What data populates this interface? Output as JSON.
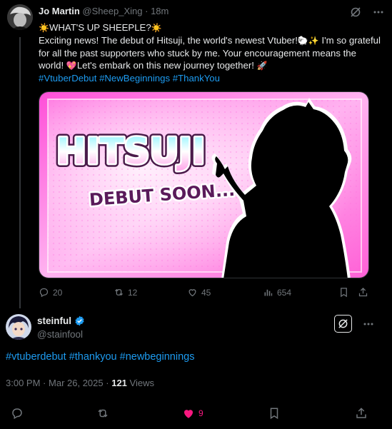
{
  "parent_tweet": {
    "author_name": "Jo Martin",
    "handle": "@Sheep_Xing",
    "separator": "·",
    "time": "18m",
    "text_line_1": "WHAT'S UP SHEEPLE?",
    "text_body": "Exciting news! The debut of Hitsuji, the world's newest Vtuber!",
    "text_body_2": "I'm so grateful for all the past supporters who stuck by me. Your encouragement means the world!",
    "text_body_3": "Let's embark on this new journey together!",
    "hashtags": [
      "#VtuberDebut",
      "#NewBeginnings",
      "#ThankYou"
    ],
    "image": {
      "title": "HITSUJI",
      "subtitle": "DEBUT SOON..."
    },
    "stats": {
      "replies": "20",
      "reposts": "12",
      "likes": "45",
      "views": "654"
    }
  },
  "reply_tweet": {
    "author_name": "steinful",
    "handle": "@stainfool",
    "hashtags": [
      "#vtuberdebut",
      "#thankyou",
      "#newbeginnings"
    ],
    "time": "3:00 PM",
    "separator": "·",
    "date": "Mar 26, 2025",
    "separator_2": "·",
    "views_count": "121",
    "views_label": "Views",
    "stats": {
      "likes": "9"
    }
  },
  "colors": {
    "link": "#1d9bf0",
    "like_active": "#f91880",
    "muted": "#71767b",
    "background": "#000000",
    "verified": "#1d9bf0"
  },
  "icons": [
    "grok-icon",
    "more-icon",
    "reply-icon",
    "repost-icon",
    "like-icon",
    "views-icon",
    "bookmark-icon",
    "share-icon",
    "verified-icon"
  ]
}
